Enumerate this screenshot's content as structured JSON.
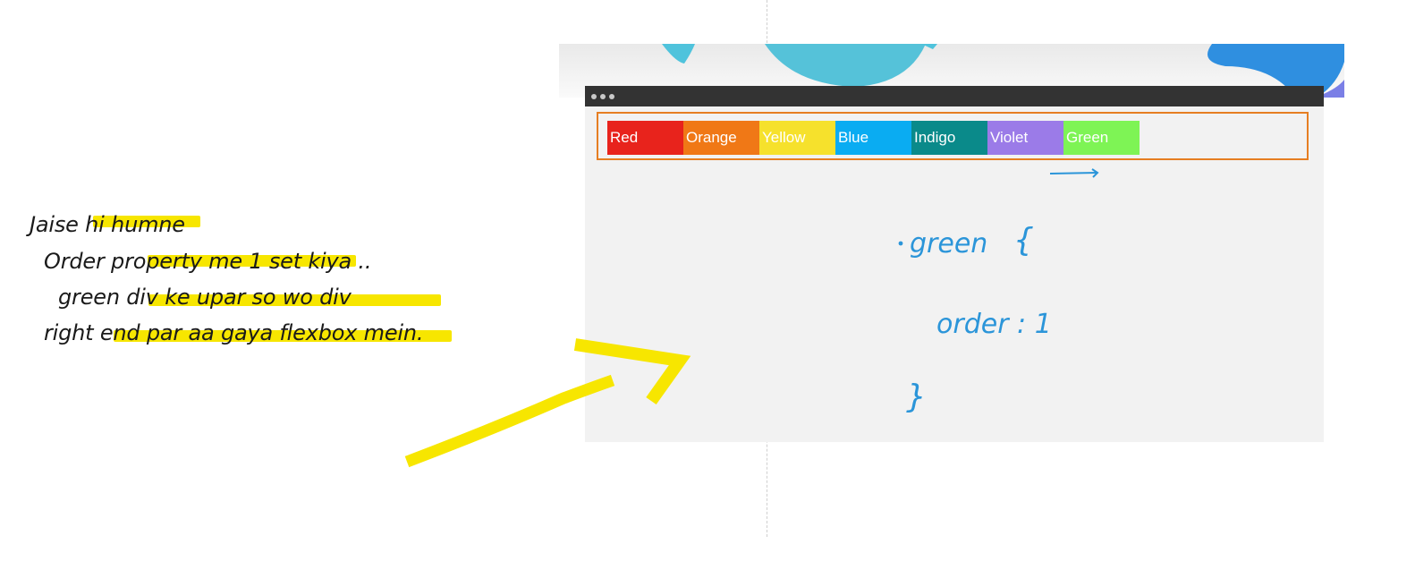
{
  "note": {
    "lines": [
      "Jaise hi humne",
      "Order property me 1 set kiya ..",
      "green div ke upar so wo div",
      "right end par aa gaya flexbox mein."
    ]
  },
  "browser": {
    "flex_items": [
      {
        "label": "Red",
        "color": "#e8231c"
      },
      {
        "label": "Orange",
        "color": "#f07816"
      },
      {
        "label": "Yellow",
        "color": "#f6e12c"
      },
      {
        "label": "Blue",
        "color": "#0aacf2"
      },
      {
        "label": "Indigo",
        "color": "#0a8a8a"
      },
      {
        "label": "Violet",
        "color": "#9b7be8"
      },
      {
        "label": "Green",
        "color": "#7ef455"
      }
    ]
  },
  "handwriting": {
    "selector": "green",
    "brace_open": "{",
    "property_line": "order : 1",
    "brace_close": "}"
  },
  "colors": {
    "highlight": "#f7e600",
    "ink": "#2b95d9",
    "container_border": "#e67e22"
  }
}
